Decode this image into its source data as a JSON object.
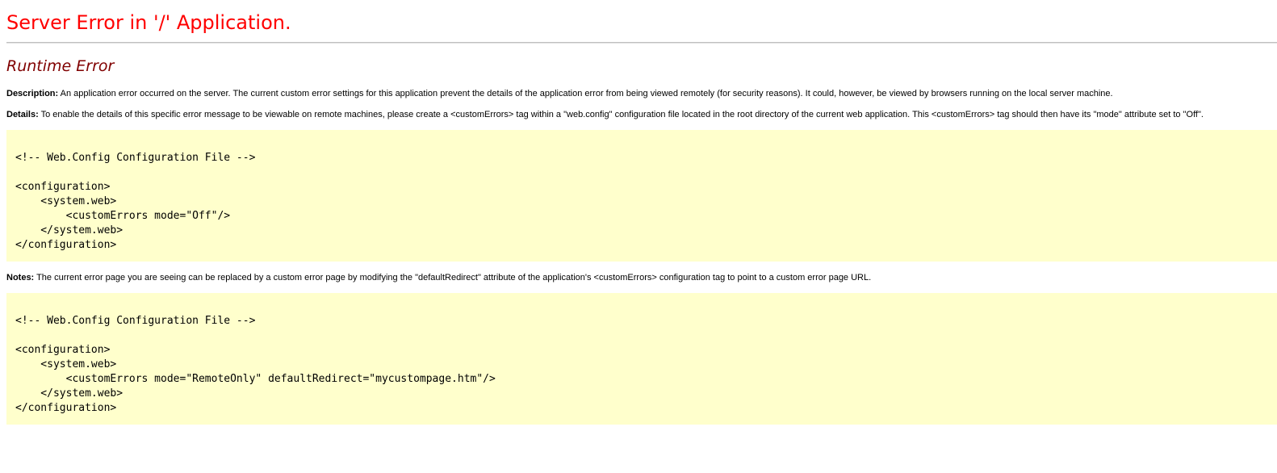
{
  "header": {
    "title": "Server Error in '/' Application.",
    "subtitle": "Runtime Error"
  },
  "description": {
    "label": "Description:",
    "text": " An application error occurred on the server. The current custom error settings for this application prevent the details of the application error from being viewed remotely (for security reasons). It could, however, be viewed by browsers running on the local server machine."
  },
  "details": {
    "label": "Details:",
    "text": " To enable the details of this specific error message to be viewable on remote machines, please create a <customErrors> tag within a \"web.config\" configuration file located in the root directory of the current web application. This <customErrors> tag should then have its \"mode\" attribute set to \"Off\"."
  },
  "code_block_1": {
    "text": "<!-- Web.Config Configuration File -->\n\n<configuration>\n    <system.web>\n        <customErrors mode=\"Off\"/>\n    </system.web>\n</configuration>"
  },
  "notes": {
    "label": "Notes:",
    "text": " The current error page you are seeing can be replaced by a custom error page by modifying the \"defaultRedirect\" attribute of the application's <customErrors> configuration tag to point to a custom error page URL."
  },
  "code_block_2": {
    "text": "<!-- Web.Config Configuration File -->\n\n<configuration>\n    <system.web>\n        <customErrors mode=\"RemoteOnly\" defaultRedirect=\"mycustompage.htm\"/>\n    </system.web>\n</configuration>"
  },
  "colors": {
    "title": "#ff0000",
    "subtitle": "#800000",
    "code_background": "#ffffcc",
    "rule": "#c0c0c0"
  }
}
